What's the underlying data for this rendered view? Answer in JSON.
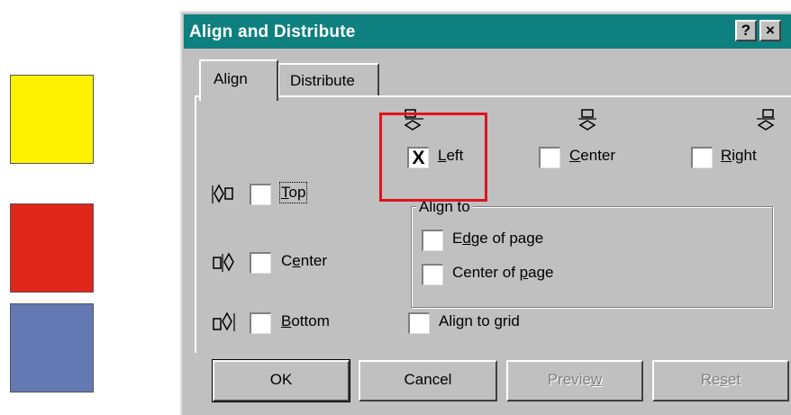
{
  "swatches": [
    {
      "name": "yellow",
      "color": "#fff200"
    },
    {
      "name": "red",
      "color": "#e1261c"
    },
    {
      "name": "blue",
      "color": "#6478b4"
    }
  ],
  "dialog": {
    "title": "Align and Distribute",
    "help_label": "?",
    "close_label": "×",
    "titlebar_color": "#0f8080"
  },
  "tabs": {
    "align": "Align",
    "distribute": "Distribute"
  },
  "horizontal": {
    "left": {
      "pre": "",
      "key": "L",
      "post": "eft",
      "checked_mark": "X"
    },
    "center": {
      "pre": "",
      "key": "C",
      "post": "enter",
      "checked_mark": ""
    },
    "right": {
      "pre": "",
      "key": "R",
      "post": "ight",
      "checked_mark": ""
    }
  },
  "vertical": {
    "top": {
      "pre": "",
      "key": "T",
      "post": "op",
      "checked_mark": ""
    },
    "center": {
      "pre": "C",
      "key": "e",
      "post": "nter",
      "checked_mark": ""
    },
    "bottom": {
      "pre": "",
      "key": "B",
      "post": "ottom",
      "checked_mark": ""
    }
  },
  "align_to": {
    "title": "Align to",
    "edge": {
      "pre": "E",
      "key": "d",
      "post": "ge of page"
    },
    "center": {
      "pre": "Center of ",
      "key": "p",
      "post": "age"
    }
  },
  "grid": {
    "pre": "Align to ",
    "key": "g",
    "post": "rid"
  },
  "buttons": {
    "ok": "OK",
    "cancel": "Cancel",
    "preview": {
      "pre": "Previe",
      "key": "w",
      "post": ""
    },
    "reset": {
      "pre": "Re",
      "key": "s",
      "post": "et"
    }
  },
  "highlight_color": "#e0141e"
}
